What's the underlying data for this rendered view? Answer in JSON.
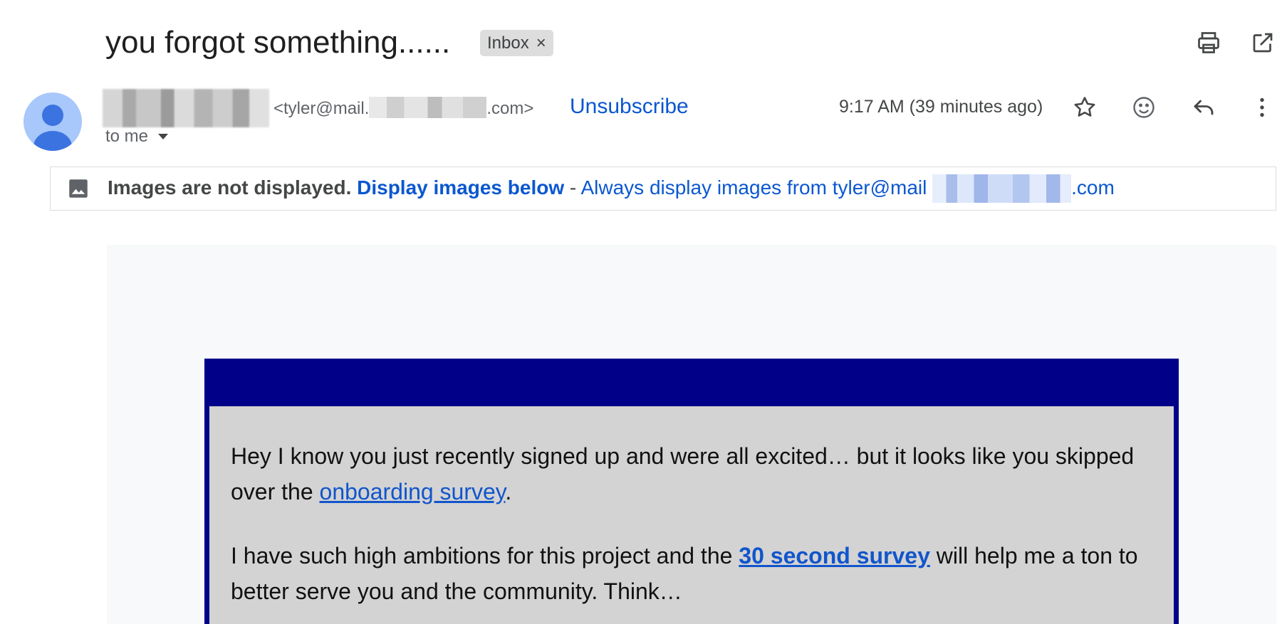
{
  "subject": {
    "title": "you forgot something......",
    "label": "Inbox",
    "label_remove": "×"
  },
  "toolbar": {
    "print_icon": "print-icon",
    "open_new_window_icon": "open-in-new-window-icon"
  },
  "sender": {
    "email_prefix": "<tyler@mail.",
    "email_suffix": ".com>",
    "unsubscribe": "Unsubscribe",
    "to": "to me",
    "timestamp": "9:17 AM (39 minutes ago)"
  },
  "actions": {
    "star_icon": "star-icon",
    "emoji_icon": "emoji-reaction-icon",
    "reply_icon": "reply-icon",
    "more_icon": "more-vert-icon"
  },
  "images_banner": {
    "notice": "Images are not displayed.",
    "display_below": "Display images below",
    "separator": " - ",
    "always_display": "Always display images from tyler@mail",
    "always_display_suffix": ".com"
  },
  "email_body": {
    "p1_start": "Hey I know you just recently signed up and were all excited… but it looks like you skipped over the ",
    "p1_link": "onboarding survey",
    "p1_end": ".",
    "p2_start": "I have such high ambitions for this project and the ",
    "p2_link": "30 second survey",
    "p2_end": " will help me a ton to better serve you and the community. Think…"
  },
  "colors": {
    "link": "#0b57d0",
    "frame": "#000088",
    "content_bg": "#d3d3d3",
    "avatar": "#a8c7fa"
  }
}
